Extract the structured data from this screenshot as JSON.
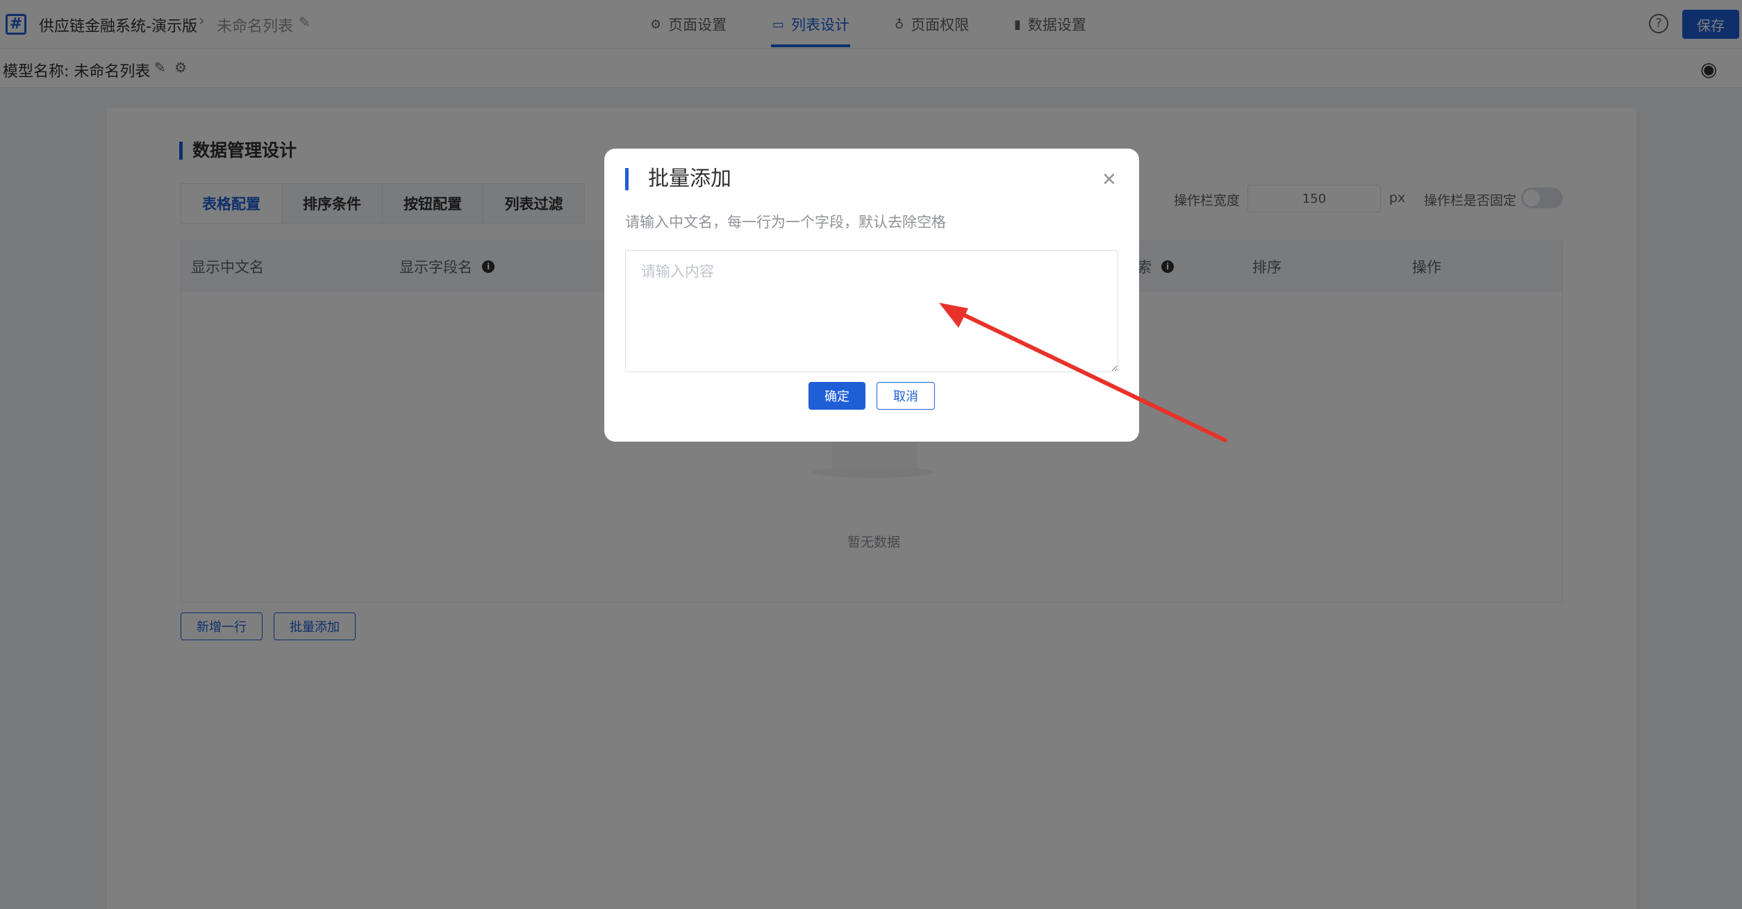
{
  "header": {
    "app_name": "供应链金融系统-演示版",
    "breadcrumb_sep": "›",
    "current_page": "未命名列表",
    "nav": [
      {
        "label": "页面设置",
        "icon": "⚙",
        "active": false
      },
      {
        "label": "列表设计",
        "icon": "▭",
        "active": true
      },
      {
        "label": "页面权限",
        "icon": "♁",
        "active": false
      },
      {
        "label": "数据设置",
        "icon": "▮",
        "active": false
      }
    ],
    "help": "?",
    "save_label": "保存"
  },
  "model_bar": {
    "label": "模型名称: 未命名列表"
  },
  "section": {
    "title": "数据管理设计",
    "tabs": [
      "表格配置",
      "排序条件",
      "按钮配置",
      "列表过滤"
    ],
    "op_width_label": "操作栏宽度",
    "op_width_value": "150",
    "op_width_unit": "px",
    "op_fixed_label": "操作栏是否固定"
  },
  "table": {
    "headers": [
      "显示中文名",
      "显示字段名",
      "索",
      "排序",
      "操作"
    ],
    "empty_text": "暂无数据"
  },
  "bottom_buttons": {
    "add_row": "新增一行",
    "batch_add": "批量添加"
  },
  "modal": {
    "title": "批量添加",
    "hint": "请输入中文名，每一行为一个字段，默认去除空格",
    "placeholder": "请输入内容",
    "value": "",
    "ok_label": "确定",
    "cancel_label": "取消"
  },
  "colors": {
    "accent": "#1f5fd6",
    "annotation_arrow": "#e8322a"
  }
}
